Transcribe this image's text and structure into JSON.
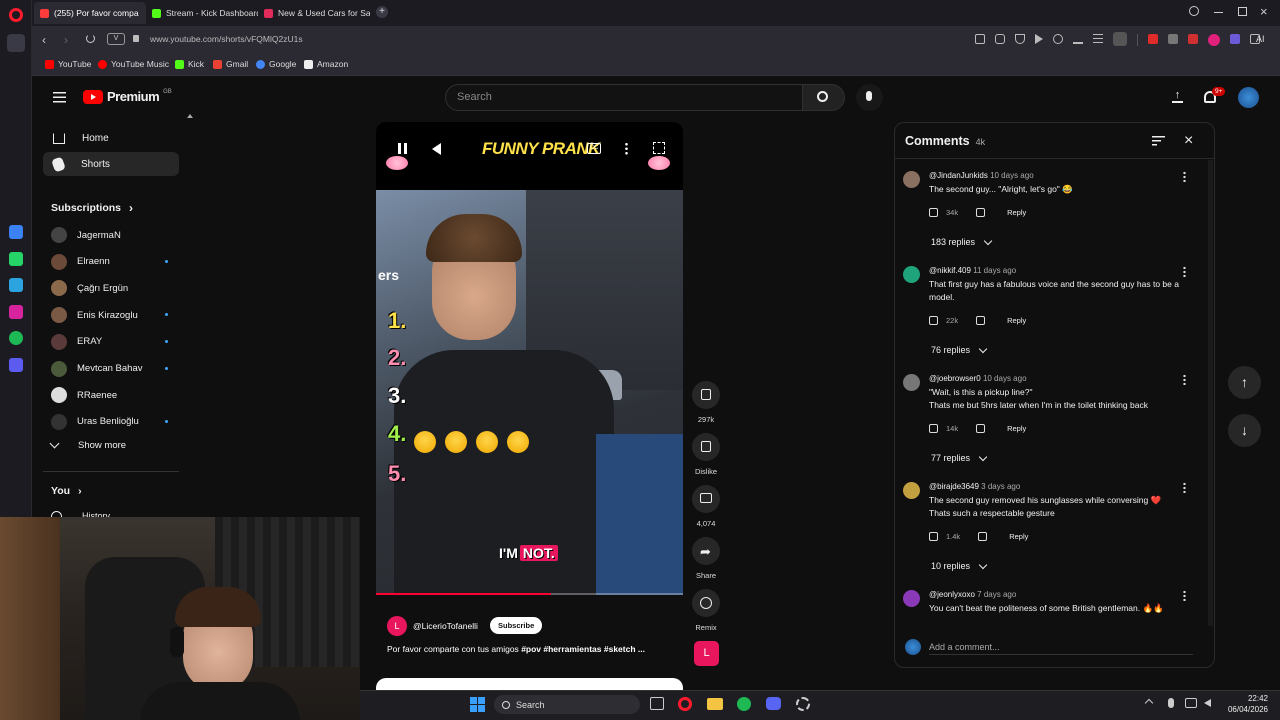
{
  "browser": {
    "tabs": [
      {
        "label": "(255) Por favor compa",
        "active": true,
        "color": "#ff3b3b"
      },
      {
        "label": "Stream - Kick Dashboard",
        "active": false,
        "color": "#53fc18"
      },
      {
        "label": "New & Used Cars for Sale",
        "active": false,
        "color": "#e02b5b"
      }
    ],
    "address_badge": "V",
    "url": "www.youtube.com/shorts/vFQMlQ2zU1s",
    "ai_label": "AI",
    "bookmarks": [
      {
        "label": "YouTube",
        "color": "#ff0000"
      },
      {
        "label": "YouTube Music",
        "color": "#ff0000"
      },
      {
        "label": "Kick",
        "color": "#53fc18"
      },
      {
        "label": "Gmail",
        "color": "#ea4335"
      },
      {
        "label": "Google",
        "color": "#4285f4"
      },
      {
        "label": "Amazon",
        "color": "#ffffff"
      }
    ]
  },
  "youtube": {
    "logo_text": "Premium",
    "logo_badge": "GB",
    "search_placeholder": "Search",
    "notification_count": "9+",
    "nav": [
      {
        "label": "Home",
        "icon": "home-icon"
      },
      {
        "label": "Shorts",
        "icon": "shorts-icon"
      }
    ],
    "subscriptions_title": "Subscriptions",
    "subscriptions": [
      {
        "name": "JagermaN",
        "dot": false,
        "color": "#444"
      },
      {
        "name": "Elraenn",
        "dot": true,
        "color": "#6b4a3a"
      },
      {
        "name": "Çağrı Ergün",
        "dot": false,
        "color": "#8a6a4a"
      },
      {
        "name": "Enis Kirazoglu",
        "dot": true,
        "color": "#7a5a44"
      },
      {
        "name": "ERAY",
        "dot": true,
        "color": "#5a3a3a"
      },
      {
        "name": "Mevtcan Bahav",
        "dot": true,
        "color": "#4a5a3a"
      },
      {
        "name": "RRaenee",
        "dot": false,
        "color": "#ddd"
      },
      {
        "name": "Uras Benlioğlu",
        "dot": true,
        "color": "#333"
      }
    ],
    "show_more": "Show more",
    "you_label": "You",
    "history_label": "History"
  },
  "short": {
    "overlay_title": "FUNNY PRANK",
    "ranks": [
      "1.",
      "2.",
      "3.",
      "4.",
      "5."
    ],
    "caption": "I'M NOT.",
    "caption_highlight": "NOT.",
    "channel": "@LicerioTofanelli",
    "channel_initial": "L",
    "subscribe_label": "Subscribe",
    "description": "Por favor comparte con tus amigos",
    "hashtags": "#pov #herramientas #sketch ...",
    "sign_text": "ers",
    "progress": 0.57,
    "actions": [
      {
        "name": "like",
        "label": "297k"
      },
      {
        "name": "dislike",
        "label": "Dislike"
      },
      {
        "name": "comments",
        "label": "4,074"
      },
      {
        "name": "share",
        "label": "Share"
      },
      {
        "name": "remix",
        "label": "Remix"
      }
    ]
  },
  "comments": {
    "title": "Comments",
    "count": "4k",
    "add_placeholder": "Add a comment...",
    "items": [
      {
        "user": "@JindanJunkids",
        "time": "10 days ago",
        "text": "The second guy... \"Alright, let's go\" 😂",
        "likes": "34k",
        "replies": "183 replies",
        "color": "#8a7060"
      },
      {
        "user": "@nikkif.409",
        "time": "11 days ago",
        "text": "That first guy has a fabulous voice and the second guy has to be a model.",
        "likes": "22k",
        "replies": "76 replies",
        "color": "#1fa37a"
      },
      {
        "user": "@joebrowser0",
        "time": "10 days ago",
        "text": "\"Wait, is this a pickup line?\"\nThats me but 5hrs later when I'm in the toilet thinking back",
        "likes": "14k",
        "replies": "77 replies",
        "color": "#777"
      },
      {
        "user": "@birajde3649",
        "time": "3 days ago",
        "text": "The second guy removed his sunglasses while conversing ❤️\nThats such a respectable gesture",
        "likes": "1.4k",
        "replies": "10 replies",
        "color": "#c2a040"
      },
      {
        "user": "@jeonlyxoxo",
        "time": "7 days ago",
        "text": "You can't beat the politeness of some British gentleman. 🔥🔥",
        "likes": "",
        "replies": "",
        "color": "#8a3ab9"
      }
    ],
    "reply_label": "Reply"
  },
  "taskbar": {
    "search_label": "Search",
    "time": "22:42",
    "date": "06/04/2026"
  }
}
